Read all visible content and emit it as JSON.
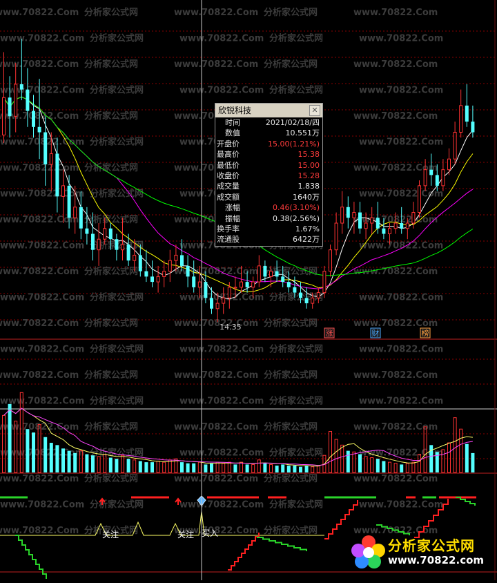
{
  "stock_name": "欣锐科技",
  "watermarks": [
    "www.70822.Com",
    "分析家公式网"
  ],
  "info_panel": {
    "title": "欣锐科技",
    "rows": [
      {
        "label": "时间",
        "value": "2021/02/18/四",
        "red": false,
        "center": true
      },
      {
        "label": "数值",
        "value": "10.551万",
        "red": false,
        "center": true
      },
      {
        "label": "开盘价",
        "value": "15.00(1.21%)",
        "red": true,
        "center": false
      },
      {
        "label": "最高价",
        "value": "15.38",
        "red": true,
        "center": false
      },
      {
        "label": "最低价",
        "value": "15.00",
        "red": true,
        "center": false
      },
      {
        "label": "收盘价",
        "value": "15.28",
        "red": true,
        "center": false
      },
      {
        "label": "成交量",
        "value": "1.838",
        "red": false,
        "center": false
      },
      {
        "label": "成交额",
        "value": "1640万",
        "red": false,
        "center": false
      },
      {
        "label": "涨幅",
        "value": "0.46(3.10%)",
        "red": true,
        "center": true
      },
      {
        "label": "振幅",
        "value": "0.38(2.56%)",
        "red": false,
        "center": true
      },
      {
        "label": "换手率",
        "value": "1.67%",
        "red": false,
        "center": false
      },
      {
        "label": "流通股",
        "value": "6422万",
        "red": false,
        "center": false
      }
    ]
  },
  "markers": [
    {
      "text": "涨",
      "color": "#ff5050"
    },
    {
      "text": "财",
      "color": "#4aa8ff"
    },
    {
      "text": "榜",
      "color": "#ffa040"
    }
  ],
  "signal_labels": {
    "watch": "关注",
    "buy": "买入"
  },
  "logo": {
    "name": "分析家公式网",
    "url": "www.70822.com"
  },
  "colors": {
    "up": "#ff3232",
    "down": "#54ffff",
    "ma5": "#ffffff",
    "ma10": "#ffff00",
    "ma20": "#ff00ff",
    "ma60": "#00ff00",
    "grid": "#8b0000"
  },
  "chart_data": {
    "type": "candlestick",
    "low_label": "14.35",
    "price": [
      [
        17.85,
        19.4,
        17.7,
        18.55
      ],
      [
        18.55,
        18.95,
        17.8,
        18.2
      ],
      [
        18.2,
        19.2,
        17.9,
        18.8
      ],
      [
        18.8,
        19.65,
        18.5,
        18.7
      ],
      [
        18.7,
        19.1,
        18.0,
        18.3
      ],
      [
        18.3,
        18.6,
        17.8,
        18.0
      ],
      [
        18.0,
        18.9,
        17.4,
        17.9
      ],
      [
        17.9,
        18.2,
        16.9,
        17.3
      ],
      [
        17.3,
        17.9,
        16.8,
        17.5
      ],
      [
        17.5,
        17.8,
        16.4,
        16.7
      ],
      [
        16.7,
        17.2,
        16.2,
        16.9
      ],
      [
        16.9,
        17.1,
        16.1,
        16.3
      ],
      [
        16.3,
        16.9,
        16.0,
        16.5
      ],
      [
        16.5,
        16.8,
        15.9,
        16.1
      ],
      [
        16.1,
        16.5,
        15.8,
        16.0
      ],
      [
        16.0,
        16.4,
        15.5,
        15.7
      ],
      [
        15.7,
        16.2,
        15.4,
        15.9
      ],
      [
        15.9,
        16.3,
        15.8,
        16.1
      ],
      [
        16.1,
        16.2,
        15.7,
        15.9
      ],
      [
        15.9,
        16.0,
        15.5,
        15.7
      ],
      [
        15.7,
        16.3,
        15.5,
        15.8
      ],
      [
        15.8,
        16.0,
        15.4,
        15.5
      ],
      [
        15.5,
        15.9,
        15.3,
        15.6
      ],
      [
        15.6,
        15.8,
        15.2,
        15.3
      ],
      [
        15.3,
        15.7,
        15.1,
        15.2
      ],
      [
        15.2,
        15.5,
        15.0,
        15.1
      ],
      [
        15.1,
        15.4,
        14.9,
        15.2
      ],
      [
        15.2,
        15.5,
        15.0,
        15.3
      ],
      [
        15.3,
        15.7,
        15.1,
        15.5
      ],
      [
        15.5,
        15.8,
        15.3,
        15.6
      ],
      [
        15.6,
        15.9,
        15.3,
        15.4
      ],
      [
        15.4,
        15.6,
        15.0,
        15.2
      ],
      [
        15.2,
        15.5,
        14.9,
        15.0
      ],
      [
        15.0,
        15.4,
        14.8,
        15.1
      ],
      [
        15.1,
        15.3,
        14.7,
        14.8
      ],
      [
        14.8,
        15.0,
        14.5,
        14.6
      ],
      [
        14.6,
        14.9,
        14.35,
        14.7
      ],
      [
        14.7,
        15.0,
        14.5,
        14.8
      ],
      [
        14.8,
        15.1,
        14.6,
        15.0
      ],
      [
        15.0,
        15.2,
        14.8,
        15.0
      ],
      [
        15.0,
        15.4,
        14.9,
        15.1
      ],
      [
        15.1,
        15.3,
        14.9,
        15.0
      ],
      [
        15.0,
        15.2,
        14.8,
        15.1
      ],
      [
        15.1,
        15.6,
        15.0,
        15.4
      ],
      [
        15.4,
        15.5,
        15.1,
        15.2
      ],
      [
        15.2,
        15.4,
        15.0,
        15.3
      ],
      [
        15.3,
        15.5,
        15.1,
        15.2
      ],
      [
        15.2,
        15.4,
        15.0,
        15.1
      ],
      [
        15.1,
        15.3,
        14.9,
        15.0
      ],
      [
        15.0,
        15.2,
        14.8,
        14.9
      ],
      [
        14.9,
        15.1,
        14.7,
        14.8
      ],
      [
        14.8,
        15.0,
        14.6,
        14.7
      ],
      [
        14.7,
        14.9,
        14.6,
        14.8
      ],
      [
        14.8,
        15.0,
        14.7,
        14.9
      ],
      [
        14.9,
        15.4,
        14.8,
        15.3
      ],
      [
        15.3,
        15.8,
        15.2,
        15.7
      ],
      [
        15.7,
        16.4,
        15.6,
        16.2
      ],
      [
        16.2,
        16.8,
        16.0,
        16.5
      ],
      [
        16.5,
        16.7,
        16.1,
        16.3
      ],
      [
        16.3,
        16.6,
        16.0,
        16.4
      ],
      [
        16.4,
        16.6,
        16.0,
        16.1
      ],
      [
        16.1,
        16.4,
        15.9,
        16.2
      ],
      [
        16.2,
        16.5,
        16.0,
        16.3
      ],
      [
        16.3,
        16.6,
        16.0,
        16.1
      ],
      [
        16.1,
        16.3,
        15.9,
        16.0
      ],
      [
        16.0,
        16.2,
        15.8,
        16.1
      ],
      [
        16.1,
        16.4,
        16.0,
        16.2
      ],
      [
        16.2,
        16.5,
        16.0,
        16.1
      ],
      [
        16.1,
        16.3,
        15.9,
        16.2
      ],
      [
        16.2,
        16.6,
        16.1,
        16.4
      ],
      [
        16.4,
        17.0,
        16.3,
        16.9
      ],
      [
        16.9,
        17.4,
        16.8,
        17.2
      ],
      [
        17.2,
        17.5,
        16.9,
        17.1
      ],
      [
        17.1,
        17.3,
        16.8,
        16.9
      ],
      [
        16.9,
        17.4,
        16.8,
        17.2
      ],
      [
        17.2,
        17.6,
        17.1,
        17.4
      ],
      [
        17.4,
        18.1,
        17.3,
        17.9
      ],
      [
        17.9,
        18.7,
        17.8,
        18.4
      ],
      [
        18.4,
        18.8,
        18.0,
        18.1
      ],
      [
        18.1,
        18.4,
        17.8,
        17.9
      ]
    ],
    "volume": [
      [
        5.0,
        1
      ],
      [
        6.0,
        0
      ],
      [
        4.5,
        1
      ],
      [
        7.0,
        1
      ],
      [
        3.8,
        0
      ],
      [
        3.5,
        0
      ],
      [
        4.2,
        1
      ],
      [
        3.1,
        0
      ],
      [
        2.6,
        0
      ],
      [
        2.4,
        0
      ],
      [
        2.1,
        0
      ],
      [
        1.9,
        0
      ],
      [
        1.7,
        0
      ],
      [
        1.9,
        1
      ],
      [
        1.6,
        0
      ],
      [
        1.5,
        0
      ],
      [
        1.4,
        1
      ],
      [
        1.6,
        1
      ],
      [
        1.3,
        0
      ],
      [
        1.2,
        0
      ],
      [
        1.5,
        1
      ],
      [
        1.2,
        0
      ],
      [
        1.1,
        1
      ],
      [
        1.0,
        0
      ],
      [
        0.9,
        0
      ],
      [
        0.9,
        0
      ],
      [
        1.0,
        1
      ],
      [
        0.9,
        1
      ],
      [
        1.1,
        1
      ],
      [
        1.2,
        1
      ],
      [
        0.9,
        0
      ],
      [
        0.8,
        0
      ],
      [
        0.8,
        0
      ],
      [
        0.9,
        1
      ],
      [
        0.7,
        0
      ],
      [
        0.8,
        0
      ],
      [
        0.9,
        1
      ],
      [
        0.8,
        1
      ],
      [
        0.9,
        1
      ],
      [
        0.7,
        0
      ],
      [
        0.9,
        1
      ],
      [
        0.7,
        0
      ],
      [
        0.7,
        1
      ],
      [
        1.1,
        1
      ],
      [
        0.8,
        0
      ],
      [
        0.7,
        1
      ],
      [
        0.6,
        0
      ],
      [
        0.7,
        0
      ],
      [
        0.6,
        0
      ],
      [
        0.6,
        0
      ],
      [
        0.5,
        0
      ],
      [
        0.6,
        0
      ],
      [
        0.5,
        1
      ],
      [
        0.6,
        1
      ],
      [
        1.5,
        1
      ],
      [
        3.6,
        1
      ],
      [
        2.9,
        1
      ],
      [
        2.4,
        1
      ],
      [
        1.9,
        0
      ],
      [
        1.8,
        1
      ],
      [
        1.6,
        0
      ],
      [
        1.4,
        1
      ],
      [
        1.3,
        1
      ],
      [
        1.2,
        0
      ],
      [
        1.0,
        0
      ],
      [
        0.9,
        1
      ],
      [
        0.8,
        1
      ],
      [
        0.7,
        0
      ],
      [
        0.8,
        1
      ],
      [
        0.9,
        1
      ],
      [
        1.6,
        1
      ],
      [
        4.0,
        1
      ],
      [
        2.4,
        0
      ],
      [
        1.8,
        0
      ],
      [
        2.0,
        1
      ],
      [
        2.6,
        1
      ],
      [
        4.8,
        1
      ],
      [
        3.8,
        1
      ],
      [
        2.5,
        0
      ],
      [
        1.7,
        0
      ]
    ]
  }
}
